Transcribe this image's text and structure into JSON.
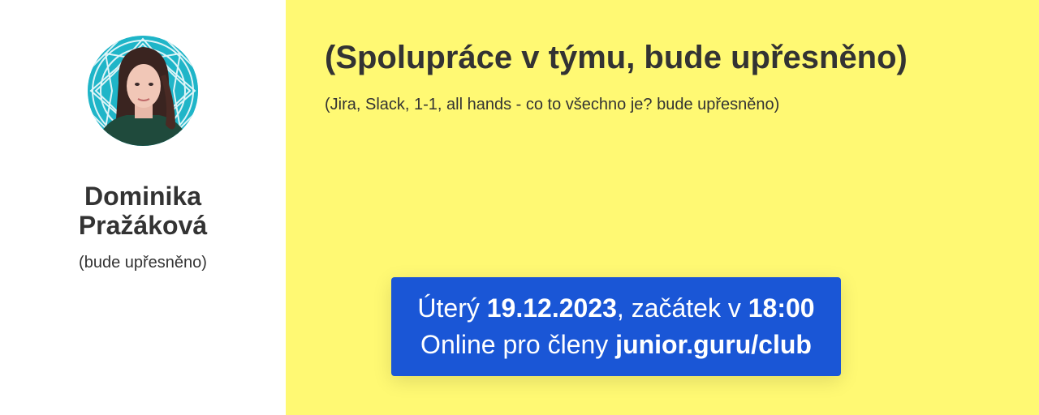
{
  "speaker": {
    "name_line1": "Dominika",
    "name_line2": "Pražáková",
    "role": "(bude upřesněno)",
    "avatar_icon": "speaker-portrait"
  },
  "talk": {
    "title": "(Spolupráce v týmu, bude upřesněno)",
    "description": "(Jira, Slack, 1-1, all hands - co to všechno je? bude upřesněno)"
  },
  "event": {
    "day": "Úterý",
    "date": "19.12.2023",
    "start_label": ", začátek v",
    "time": "18:00",
    "online_label": "Online pro členy",
    "url": "junior.guru/club"
  },
  "colors": {
    "left_background": "#ffffff",
    "right_background": "#fff973",
    "event_box": "#1a56d6",
    "avatar_ring": "#1fb5c8",
    "text": "#333333"
  }
}
